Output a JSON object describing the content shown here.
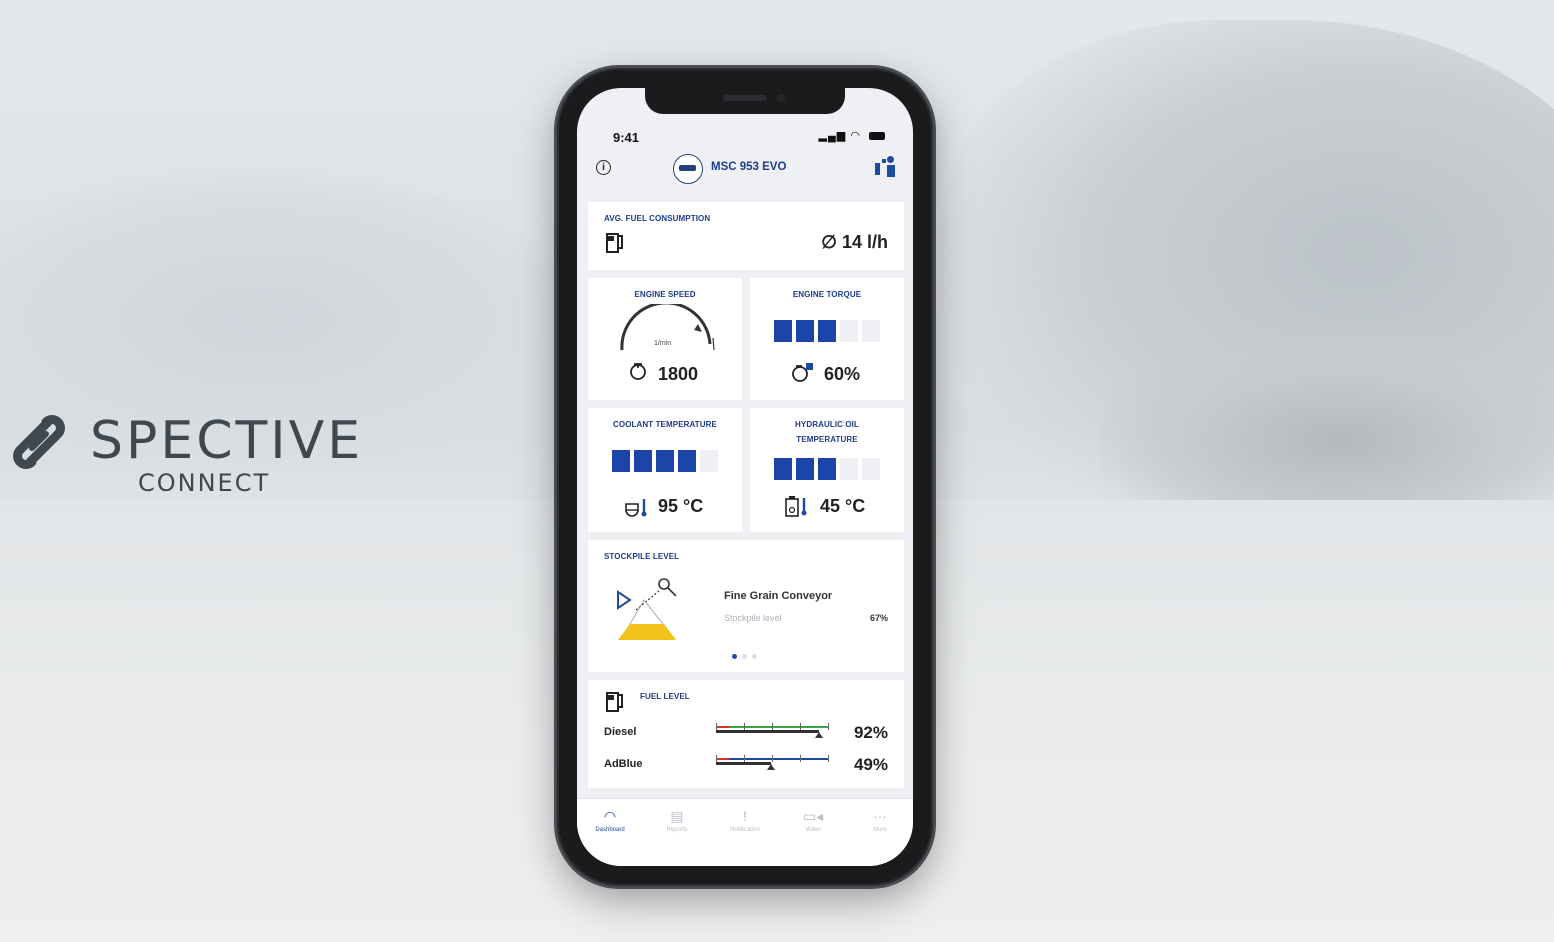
{
  "brand": {
    "name": "SPECTIVE",
    "sub": "CONNECT"
  },
  "status_bar": {
    "time": "9:41"
  },
  "header": {
    "machine_name": "MSC 953 EVO"
  },
  "avg_fuel": {
    "title": "AVG. FUEL CONSUMPTION",
    "value": "∅ 14 l/h"
  },
  "engine_speed": {
    "title": "ENGINE SPEED",
    "unit": "1/min",
    "value": "1800"
  },
  "engine_torque": {
    "title": "ENGINE TORQUE",
    "value": "60%",
    "level": 0.6
  },
  "coolant": {
    "title": "COOLANT TEMPERATURE",
    "value": "95 °C",
    "level": 0.8
  },
  "hydraulic": {
    "title_line1": "HYDRAULIC OIL",
    "title_line2": "TEMPERATURE",
    "value": "45 °C",
    "level": 0.6
  },
  "stockpile": {
    "title": "STOCKPILE LEVEL",
    "conveyor": "Fine Grain Conveyor",
    "label": "Stockpile level",
    "value": "67%"
  },
  "fuel_level": {
    "title": "FUEL LEVEL",
    "rows": [
      {
        "name": "Diesel",
        "value": "92%",
        "level": 0.92
      },
      {
        "name": "AdBlue",
        "value": "49%",
        "level": 0.49
      }
    ]
  },
  "tabs": [
    {
      "label": "Dashboard",
      "icon": "gauge-icon",
      "active": true
    },
    {
      "label": "Reports",
      "icon": "document-icon",
      "active": false
    },
    {
      "label": "Notification",
      "icon": "exclamation-icon",
      "active": false
    },
    {
      "label": "Video",
      "icon": "video-camera-icon",
      "active": false
    },
    {
      "label": "More",
      "icon": "more-dots-icon",
      "active": false
    }
  ],
  "colors": {
    "accent": "#1b46a8",
    "title": "#1e3c8c",
    "stockpile": "#f2c21a",
    "gauge_green": "#3aa64a",
    "gauge_red": "#d9322b",
    "gauge_blue": "#1e4aa0"
  }
}
